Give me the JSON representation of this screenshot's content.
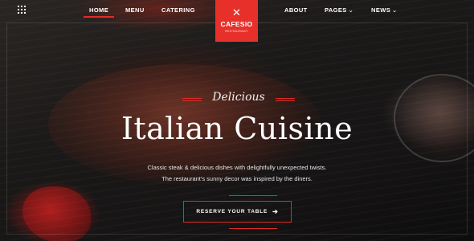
{
  "nav": {
    "menu_icon": "grid-icon",
    "items": [
      {
        "label": "HOME",
        "active": true
      },
      {
        "label": "MENU"
      },
      {
        "label": "CATERING"
      },
      {
        "label": "ABOUT"
      },
      {
        "label": "PAGES",
        "has_dropdown": true
      },
      {
        "label": "NEWS",
        "has_dropdown": true
      }
    ],
    "caret": "⌄"
  },
  "logo": {
    "icon": "fork-knife-icon",
    "icon_glyph": "✕",
    "name": "CAFESIO",
    "tagline": "RESTAURANT"
  },
  "hero": {
    "subtitle": "Delicious",
    "headline": "Italian Cuisine",
    "description_line1": "Classic steak & delicious dishes with delightfully unexpected twists.",
    "description_line2": "The restaurant's sunny decor was inspired by the diners.",
    "cta_label": "RESERVE YOUR TABLE",
    "cta_arrow": "➔"
  },
  "colors": {
    "accent": "#e8302b",
    "text": "#ffffff",
    "background": "#161414"
  }
}
